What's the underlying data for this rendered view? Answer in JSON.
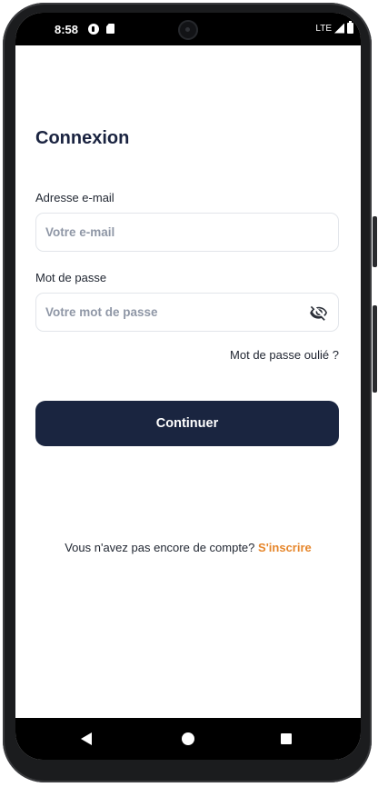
{
  "status_bar": {
    "time": "8:58",
    "network": "LTE"
  },
  "login": {
    "title": "Connexion",
    "email_label": "Adresse e-mail",
    "email_placeholder": "Votre e-mail",
    "email_value": "",
    "password_label": "Mot de passe",
    "password_placeholder": "Votre mot de passe",
    "password_value": "",
    "forgot_password": "Mot de passe oulié ?",
    "continue_label": "Continuer",
    "signup_prompt": "Vous n'avez pas encore de compte?",
    "signup_link": "S'inscrire"
  },
  "icons": {
    "password_toggle": "eye-off-icon",
    "nav_back": "back-triangle-icon",
    "nav_home": "home-circle-icon",
    "nav_recents": "recents-square-icon"
  },
  "colors": {
    "primary": "#1a2540",
    "accent": "#e6862b",
    "placeholder": "#8f97a6"
  }
}
